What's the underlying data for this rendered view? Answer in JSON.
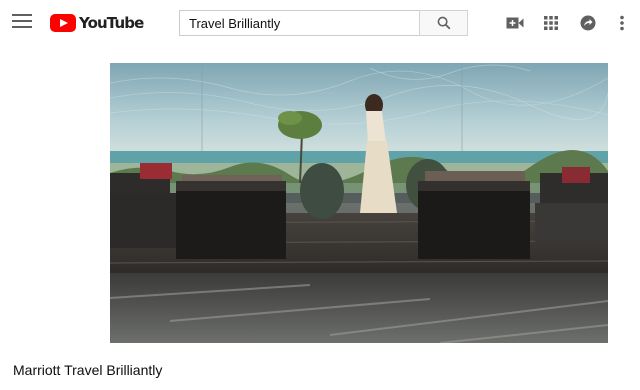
{
  "header": {
    "logo_text": "YouTube",
    "icons": [
      "hamburger-menu-icon",
      "search-icon",
      "create-video-icon",
      "apps-grid-icon",
      "share-icon",
      "more-vertical-icon"
    ]
  },
  "search": {
    "value": "Travel Brilliantly"
  },
  "video": {
    "title": "Marriott Travel Brilliantly"
  },
  "colors": {
    "brand": "#ff0000",
    "icon": "#606060"
  }
}
